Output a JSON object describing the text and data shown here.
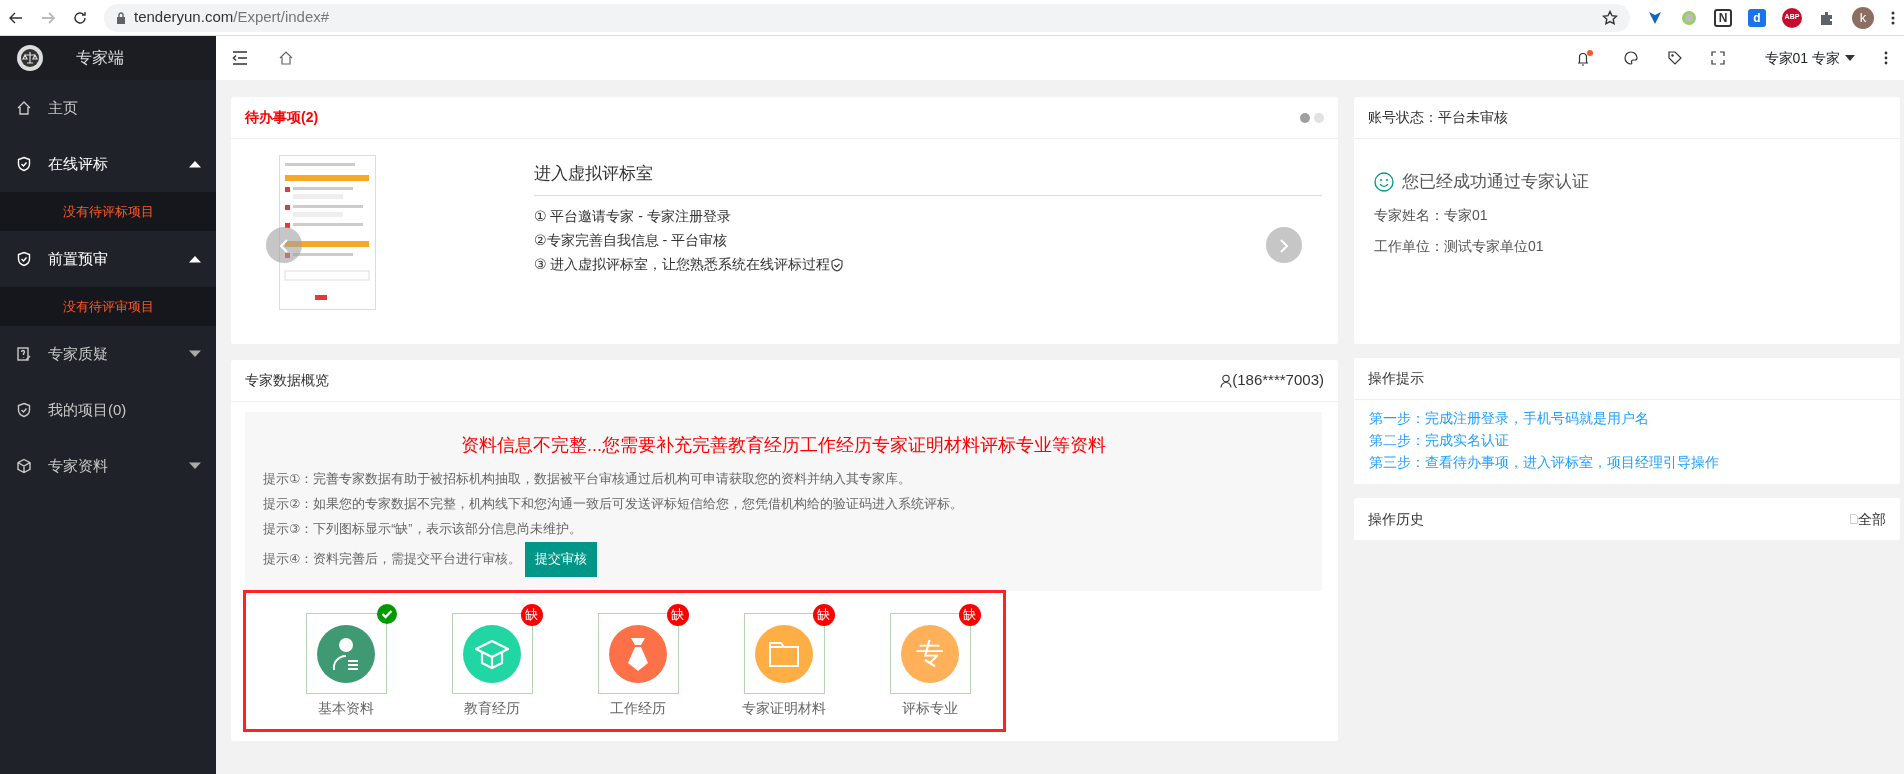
{
  "browser": {
    "url_host": "tenderyun.com",
    "url_path": "/Expert/index#",
    "extensions": [
      {
        "kind": "shield"
      },
      {
        "kind": "dot"
      },
      {
        "kind": "n",
        "glyph": "N"
      },
      {
        "kind": "d",
        "glyph": "d"
      },
      {
        "kind": "abp",
        "glyph": "ABP"
      },
      {
        "kind": "puzzle"
      }
    ],
    "profile": "k"
  },
  "sidebar": {
    "title": "专家端",
    "items": [
      {
        "label": "主页",
        "kind": "home"
      },
      {
        "label": "在线评标",
        "kind": "shield",
        "expanded": true,
        "children": [
          {
            "label": "没有待评标项目"
          }
        ]
      },
      {
        "label": "前置预审",
        "kind": "shield",
        "expanded": true,
        "children": [
          {
            "label": "没有待评审项目"
          }
        ]
      },
      {
        "label": "专家质疑",
        "kind": "question",
        "expanded": false
      },
      {
        "label": "我的项目(0)",
        "kind": "shield"
      },
      {
        "label": "专家资料",
        "kind": "cube",
        "expanded": false
      }
    ]
  },
  "header": {
    "notification": true,
    "user": "专家01 专家"
  },
  "todo": {
    "title": "待办事项(2)",
    "dots": [
      {
        "selected": true
      },
      {
        "selected": false
      }
    ],
    "slide_title": "进入虚拟评标室",
    "steps": [
      "① 平台邀请专家 - 专家注册登录",
      "②专家完善自我信息 - 平台审核",
      "③ 进入虚拟评标室，让您熟悉系统在线评标过程"
    ]
  },
  "account": {
    "status_label": "账号状态：",
    "status": "平台未审核",
    "message": "您已经成功通过专家认证",
    "fields": [
      {
        "label": "专家姓名：",
        "value": "专家01"
      },
      {
        "label": "工作单位：",
        "value": "测试专家单位01"
      }
    ]
  },
  "overview": {
    "title": "专家数据概览",
    "phone": "(186****7003)",
    "warning": "资料信息不完整...您需要补充完善教育经历工作经历专家证明材料评标专业等资料",
    "hints": [
      "提示①：完善专家数据有助于被招标机构抽取，数据被平台审核通过后机构可申请获取您的资料并纳入其专家库。",
      "提示②：如果您的专家数据不完整，机构线下和您沟通一致后可发送评标短信给您，您凭借机构给的验证码进入系统评标。",
      "提示③：下列图标显示“缺”，表示该部分信息尚未维护。",
      "提示④：资料完善后，需提交平台进行审核。"
    ],
    "submit": "提交审核",
    "materials": [
      {
        "label": "基本资料",
        "kind": "person",
        "color": "#3f9a74",
        "complete": true
      },
      {
        "label": "教育经历",
        "kind": "cap",
        "color": "#22d6a3",
        "complete": false,
        "badge": "缺"
      },
      {
        "label": "工作经历",
        "kind": "tie",
        "color": "#fd7148",
        "complete": false,
        "badge": "缺"
      },
      {
        "label": "专家证明材料",
        "kind": "folder",
        "color": "#feae44",
        "complete": false,
        "badge": "缺"
      },
      {
        "label": "评标专业",
        "kind": "glyph",
        "glyph": "专",
        "color": "#ffb058",
        "complete": false,
        "badge": "缺"
      }
    ]
  },
  "tips": {
    "title": "操作提示",
    "steps": [
      "第一步：完成注册登录，手机号码就是用户名",
      "第二步：完成实名认证",
      "第三步：查看待办事项，进入评标室，项目经理引导操作"
    ]
  },
  "history": {
    "title": "操作历史",
    "all": "全部"
  }
}
